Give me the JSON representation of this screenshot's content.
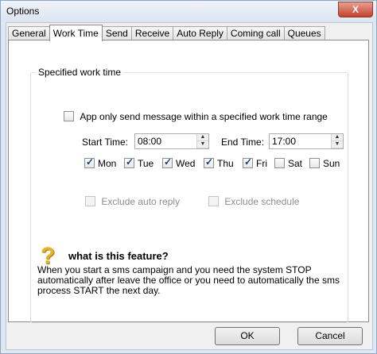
{
  "window": {
    "title": "Options",
    "close_label": "X"
  },
  "tabs": [
    {
      "label": "General"
    },
    {
      "label": "Work Time"
    },
    {
      "label": "Send"
    },
    {
      "label": "Receive"
    },
    {
      "label": "Auto Reply"
    },
    {
      "label": "Coming call"
    },
    {
      "label": "Queues"
    }
  ],
  "work_time": {
    "group_label": "Specified work time",
    "enable_label": "App only send message within a specified work time range",
    "enable_checked": false,
    "start_label": "Start Time:",
    "start_value": "08:00",
    "end_label": "End Time:",
    "end_value": "17:00",
    "days": [
      {
        "label": "Mon",
        "checked": true
      },
      {
        "label": "Tue",
        "checked": true
      },
      {
        "label": "Wed",
        "checked": true
      },
      {
        "label": "Thu",
        "checked": true
      },
      {
        "label": "Fri",
        "checked": true
      },
      {
        "label": "Sat",
        "checked": false
      },
      {
        "label": "Sun",
        "checked": false
      }
    ],
    "exclude_auto_reply": "Exclude auto reply",
    "exclude_schedule": "Exclude schedule"
  },
  "help": {
    "icon": "question-icon",
    "title": "what is this feature?",
    "body": "When you start a sms campaign and you need the system STOP automatically after leave the office or you need to automatically the sms process  START the next day."
  },
  "buttons": {
    "ok": "OK",
    "cancel": "Cancel"
  },
  "colors": {
    "help_icon": "#e8b32a",
    "check": "#1a3a7a"
  }
}
